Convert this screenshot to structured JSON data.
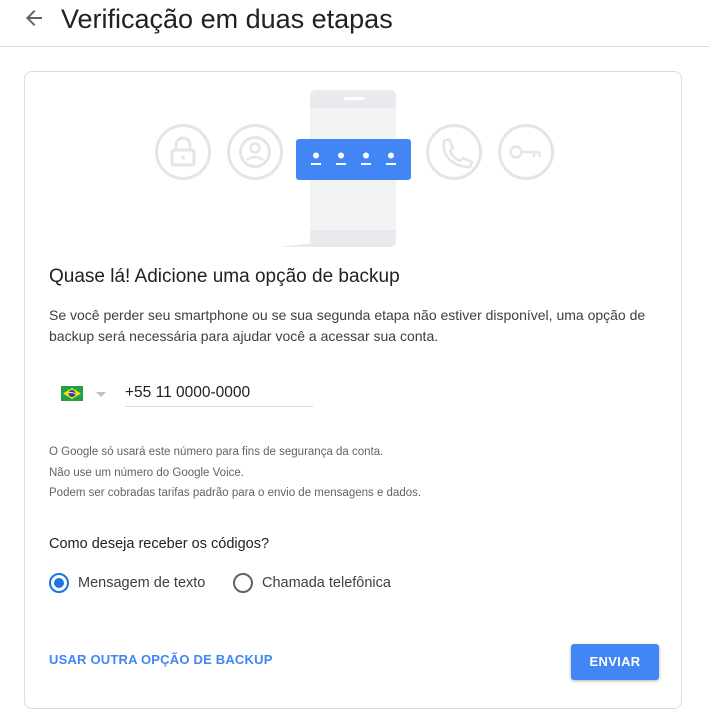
{
  "header": {
    "title": "Verificação em duas etapas",
    "back_icon": "arrow-back-icon"
  },
  "illustration": {
    "icons": [
      "lock-icon",
      "person-icon",
      "password-dots-icon",
      "phone-call-icon",
      "key-icon"
    ],
    "accent_color": "#4285f4"
  },
  "main": {
    "heading": "Quase lá! Adicione uma opção de backup",
    "description": "Se você perder seu smartphone ou se sua segunda etapa não estiver disponível, uma opção de backup será necessária para ajudar você a acessar sua conta.",
    "country": {
      "flag": "brazil-flag-icon",
      "dropdown_icon": "dropdown-arrow-icon"
    },
    "phone_value": "+55 11 0000-0000",
    "notes": [
      "O Google só usará este número para fins de segurança da conta.",
      "Não use um número do Google Voice.",
      "Podem ser cobradas tarifas padrão para o envio de mensagens e dados."
    ],
    "question": "Como deseja receber os códigos?",
    "options": [
      {
        "label": "Mensagem de texto",
        "selected": true
      },
      {
        "label": "Chamada telefônica",
        "selected": false
      }
    ]
  },
  "actions": {
    "alt_option": "USAR OUTRA OPÇÃO DE BACKUP",
    "send": "ENVIAR",
    "button_color": "#4285f4"
  }
}
